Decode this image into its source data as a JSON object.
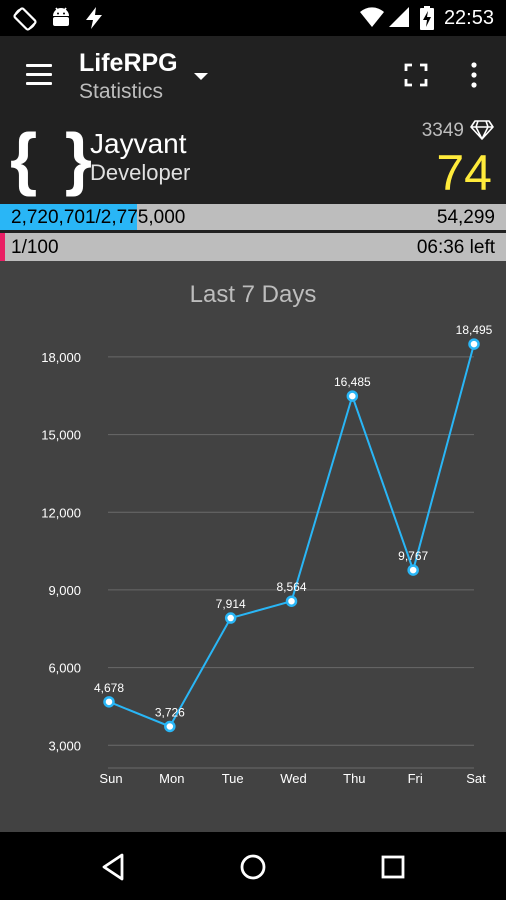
{
  "status_bar": {
    "time": "22:53",
    "icons_left": [
      "screen-rotation-icon",
      "android-debug-icon",
      "flash-icon"
    ],
    "icons_right": [
      "wifi-icon",
      "cell-signal-icon",
      "battery-charging-icon"
    ]
  },
  "app_bar": {
    "title": "LifeRPG",
    "subtitle": "Statistics"
  },
  "profile": {
    "avatar": "{ }",
    "name": "Jayvant",
    "title": "Developer",
    "gems": "3349",
    "level": "74"
  },
  "xp_bar": {
    "text": "2,720,701/2,775,000",
    "remaining": "54,299",
    "progress": 0.27,
    "color": "#29b6f6"
  },
  "hp_bar": {
    "text": "1/100",
    "time_left": "06:36 left",
    "progress": 0.01,
    "color": "#e91e63"
  },
  "chart_data": {
    "type": "line",
    "title": "Last 7 Days",
    "categories": [
      "Sun",
      "Mon",
      "Tue",
      "Wed",
      "Thu",
      "Fri",
      "Sat"
    ],
    "values": [
      4678,
      3726,
      7914,
      8564,
      16485,
      9767,
      18495
    ],
    "value_labels": [
      "4,678",
      "3,726",
      "7,914",
      "8,564",
      "16,485",
      "9,767",
      "18,495"
    ],
    "y_ticks": [
      3000,
      6000,
      9000,
      12000,
      15000,
      18000
    ],
    "y_tick_labels": [
      "3,000",
      "6,000",
      "9,000",
      "12,000",
      "15,000",
      "18,000"
    ],
    "ylim": [
      2200,
      19000
    ],
    "grid": true,
    "line_color": "#29b6f6"
  },
  "nav_bar": {
    "buttons": [
      "back-icon",
      "home-icon",
      "recents-icon"
    ]
  }
}
